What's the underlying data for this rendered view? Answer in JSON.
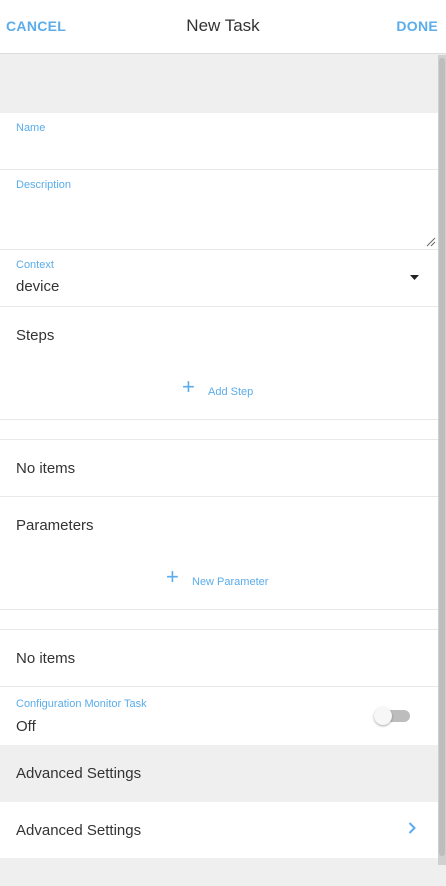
{
  "header": {
    "cancel_label": "CANCEL",
    "title": "New Task",
    "done_label": "DONE"
  },
  "form": {
    "name_label": "Name",
    "name_value": "",
    "description_label": "Description",
    "description_value": "",
    "context_label": "Context",
    "context_value": "device",
    "steps_title": "Steps",
    "add_step_label": "Add Step",
    "steps_empty": "No items",
    "parameters_title": "Parameters",
    "new_parameter_label": "New Parameter",
    "parameters_empty": "No items",
    "config_monitor_label": "Configuration Monitor Task",
    "config_monitor_value": "Off",
    "config_monitor_on": false,
    "advanced_header": "Advanced Settings",
    "advanced_item": "Advanced Settings"
  },
  "icons": {
    "dropdown": "caret-down-icon",
    "add_step": "plus-icon",
    "new_parameter": "plus-icon",
    "advanced": "chevron-right-icon"
  },
  "colors": {
    "accent": "#5aacea",
    "background": "#efefef",
    "surface": "#ffffff"
  }
}
